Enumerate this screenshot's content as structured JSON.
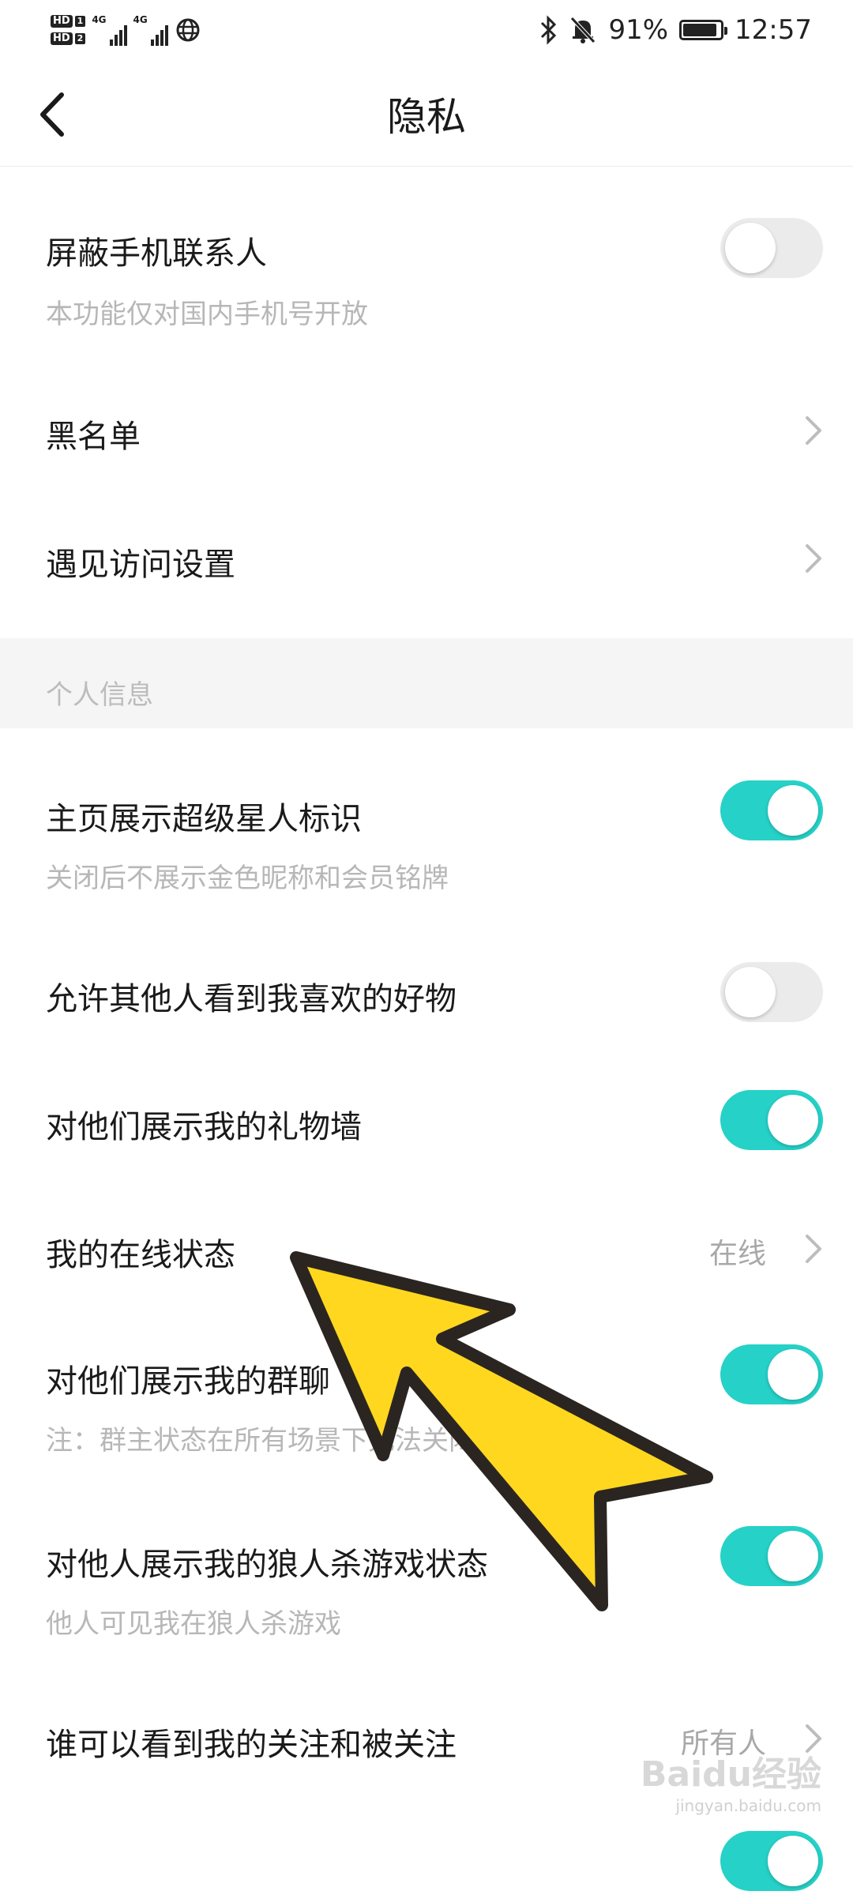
{
  "status_bar": {
    "sim1": "1",
    "sim2": "2",
    "hd": "HD",
    "net1": "4G",
    "net2": "4G",
    "battery_text": "91%",
    "battery_level": 0.91,
    "time": "12:57"
  },
  "header": {
    "title": "隐私"
  },
  "settings": {
    "block_contacts": {
      "label": "屏蔽手机联系人",
      "sub": "本功能仅对国内手机号开放",
      "on": false
    },
    "blacklist": {
      "label": "黑名单"
    },
    "encounter": {
      "label": "遇见访问设置"
    },
    "section_personal": "个人信息",
    "superstar": {
      "label": "主页展示超级星人标识",
      "sub": "关闭后不展示金色昵称和会员铭牌",
      "on": true
    },
    "liked_goods": {
      "label": "允许其他人看到我喜欢的好物",
      "on": false
    },
    "gift_wall": {
      "label": "对他们展示我的礼物墙",
      "on": true
    },
    "online_status": {
      "label": "我的在线状态",
      "value": "在线"
    },
    "group_chat": {
      "label": "对他们展示我的群聊",
      "sub": "注：群主状态在所有场景下无法关闭",
      "on": true
    },
    "werewolf": {
      "label": "对他人展示我的狼人杀游戏状态",
      "sub": "他人可见我在狼人杀游戏",
      "on": true
    },
    "follow_visibility": {
      "label": "谁可以看到我的关注和被关注",
      "value": "所有人"
    }
  },
  "overlay": {
    "arrow_color": "#FFD71F",
    "watermark": "Baidu经验",
    "watermark_sub": "jingyan.baidu.com"
  },
  "colors": {
    "accent": "#26D1C7",
    "toggle_off": "#EBEBEB",
    "section_bg": "#F5F5F5"
  }
}
